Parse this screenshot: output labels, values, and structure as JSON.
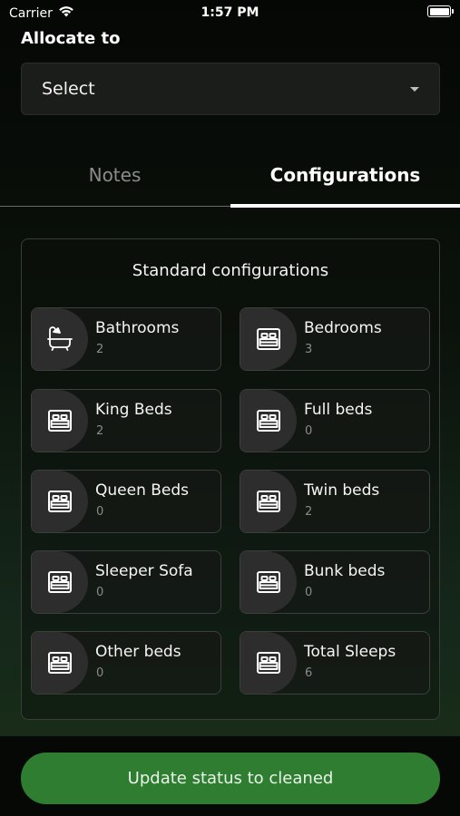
{
  "status_bar": {
    "carrier": "Carrier",
    "time": "1:57 PM"
  },
  "allocate": {
    "label": "Allocate to",
    "select_value": "Select"
  },
  "tabs": [
    {
      "label": "Notes",
      "active": false
    },
    {
      "label": "Configurations",
      "active": true
    }
  ],
  "config": {
    "title": "Standard configurations",
    "items": [
      {
        "label": "Bathrooms",
        "value": "2",
        "icon": "bathtub-icon"
      },
      {
        "label": "Bedrooms",
        "value": "3",
        "icon": "bed-icon"
      },
      {
        "label": "King Beds",
        "value": "2",
        "icon": "bed-icon"
      },
      {
        "label": "Full beds",
        "value": "0",
        "icon": "bed-icon"
      },
      {
        "label": "Queen Beds",
        "value": "0",
        "icon": "bed-icon"
      },
      {
        "label": "Twin beds",
        "value": "2",
        "icon": "bed-icon"
      },
      {
        "label": "Sleeper Sofa",
        "value": "0",
        "icon": "bed-icon"
      },
      {
        "label": "Bunk beds",
        "value": "0",
        "icon": "bed-icon"
      },
      {
        "label": "Other beds",
        "value": "0",
        "icon": "bed-icon"
      },
      {
        "label": "Total Sleeps",
        "value": "6",
        "icon": "bed-icon"
      }
    ]
  },
  "action": {
    "label": "Update status to cleaned"
  },
  "colors": {
    "accent": "#2f7d31",
    "tab_indicator": "#ffffff"
  }
}
